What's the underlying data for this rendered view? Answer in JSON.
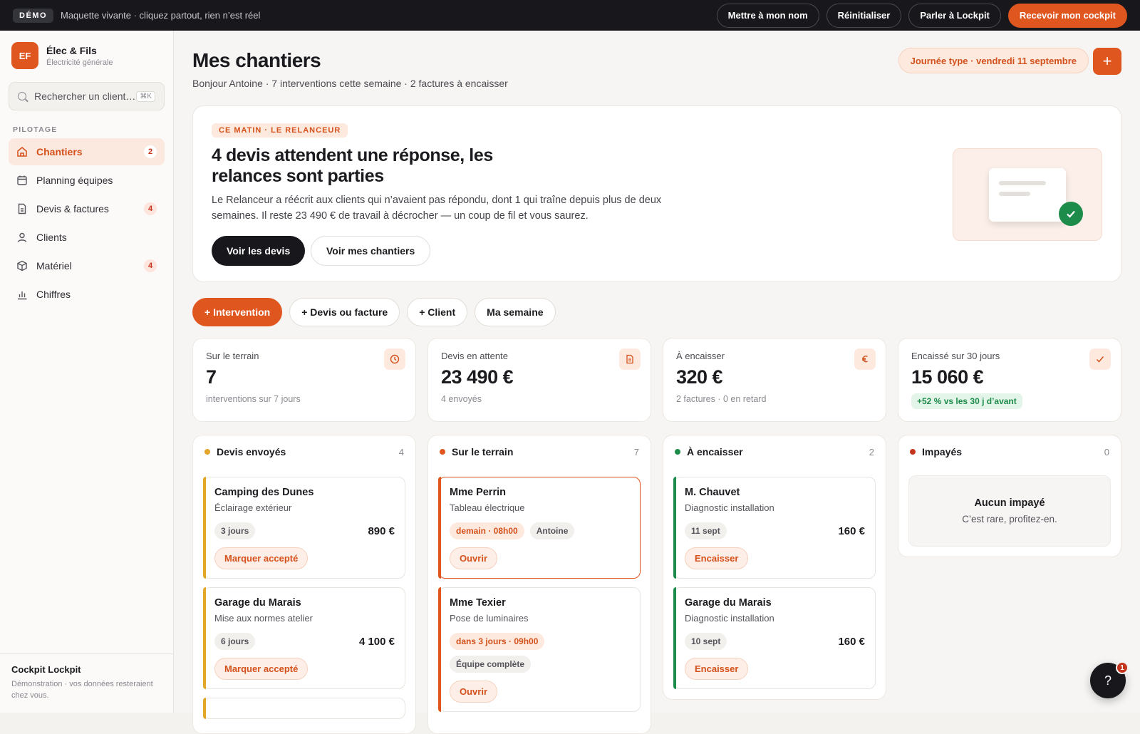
{
  "banner": {
    "badge": "DÉMO",
    "message": "Maquette vivante · cliquez partout, rien n’est réel",
    "actions": [
      "Mettre à mon nom",
      "Réinitialiser",
      "Parler à Lockpit",
      "Recevoir mon cockpit"
    ]
  },
  "sidebar": {
    "logo_initials": "EF",
    "company": "Élec & Fils",
    "company_sub": "Électricité générale",
    "search_placeholder": "Rechercher un client…",
    "search_shortcut": "⌘K",
    "section_label": "PILOTAGE",
    "items": [
      {
        "label": "Chantiers",
        "count": "2",
        "icon": "home-icon"
      },
      {
        "label": "Planning équipes",
        "count": "",
        "icon": "calendar-icon"
      },
      {
        "label": "Devis & factures",
        "count": "4",
        "icon": "document-icon"
      },
      {
        "label": "Clients",
        "count": "",
        "icon": "user-icon"
      },
      {
        "label": "Matériel",
        "count": "4",
        "icon": "box-icon"
      },
      {
        "label": "Chiffres",
        "count": "",
        "icon": "bar-chart-icon"
      }
    ],
    "footer_title": "Cockpit Lockpit",
    "footer_text": "Démonstration · vos données resteraient chez vous."
  },
  "header": {
    "title": "Mes chantiers",
    "subtitle": "Bonjour Antoine · 7 interventions cette semaine · 2 factures à encaisser",
    "date_pill": "Journée type · vendredi 11 septembre",
    "add_label": "+"
  },
  "hero": {
    "tag": "CE MATIN · LE RELANCEUR",
    "title": "4 devis attendent une réponse, les relances sont parties",
    "text": "Le Relanceur a réécrit aux clients qui n’avaient pas répondu, dont 1 qui traîne depuis plus de deux semaines. Il reste 23 490 € de travail à décrocher — un coup de fil et vous saurez.",
    "primary_btn": "Voir les devis",
    "secondary_btn": "Voir mes chantiers"
  },
  "quick_actions": [
    "+ Intervention",
    "+ Devis ou facture",
    "+ Client",
    "Ma semaine"
  ],
  "stats": [
    {
      "label": "Sur le terrain",
      "value": "7",
      "sub": "interventions sur 7 jours",
      "icon": "clock-icon"
    },
    {
      "label": "Devis en attente",
      "value": "23 490 €",
      "sub": "4 envoyés",
      "icon": "document-icon"
    },
    {
      "label": "À encaisser",
      "value": "320 €",
      "sub": "2 factures · 0 en retard",
      "icon": "euro-icon"
    },
    {
      "label": "Encaissé sur 30 jours",
      "value": "15 060 €",
      "delta": "+52 % vs les 30 j d’avant",
      "icon": "check-icon"
    }
  ],
  "board": {
    "devis": {
      "title": "Devis envoyés",
      "count": "4",
      "color": "#e3a52a",
      "cards": [
        {
          "title": "Camping des Dunes",
          "sub": "Éclairage extérieur",
          "chip": "3 jours",
          "amount": "890 €",
          "action": "Marquer accepté"
        },
        {
          "title": "Garage du Marais",
          "sub": "Mise aux normes atelier",
          "chip": "6 jours",
          "amount": "4 100 €",
          "action": "Marquer accepté"
        }
      ]
    },
    "terrain": {
      "title": "Sur le terrain",
      "count": "7",
      "color": "#e0561f",
      "cards": [
        {
          "title": "Mme Perrin",
          "sub": "Tableau électrique",
          "chip": "demain · 08h00",
          "chip2": "Antoine",
          "action": "Ouvrir"
        },
        {
          "title": "Mme Texier",
          "sub": "Pose de luminaires",
          "chip": "dans 3 jours · 09h00",
          "chip2": "Équipe complète",
          "action": "Ouvrir"
        }
      ]
    },
    "encaisser": {
      "title": "À encaisser",
      "count": "2",
      "color": "#1d8c4a",
      "cards": [
        {
          "title": "M. Chauvet",
          "sub": "Diagnostic installation",
          "chip": "11 sept",
          "amount": "160 €",
          "action": "Encaisser"
        },
        {
          "title": "Garage du Marais",
          "sub": "Diagnostic installation",
          "chip": "10 sept",
          "amount": "160 €",
          "action": "Encaisser"
        }
      ]
    },
    "impayes": {
      "title": "Impayés",
      "count": "0",
      "color": "#c4351d",
      "empty_title": "Aucun impayé",
      "empty_text": "C’est rare, profitez-en."
    }
  },
  "help": {
    "label": "?",
    "badge": "1"
  }
}
